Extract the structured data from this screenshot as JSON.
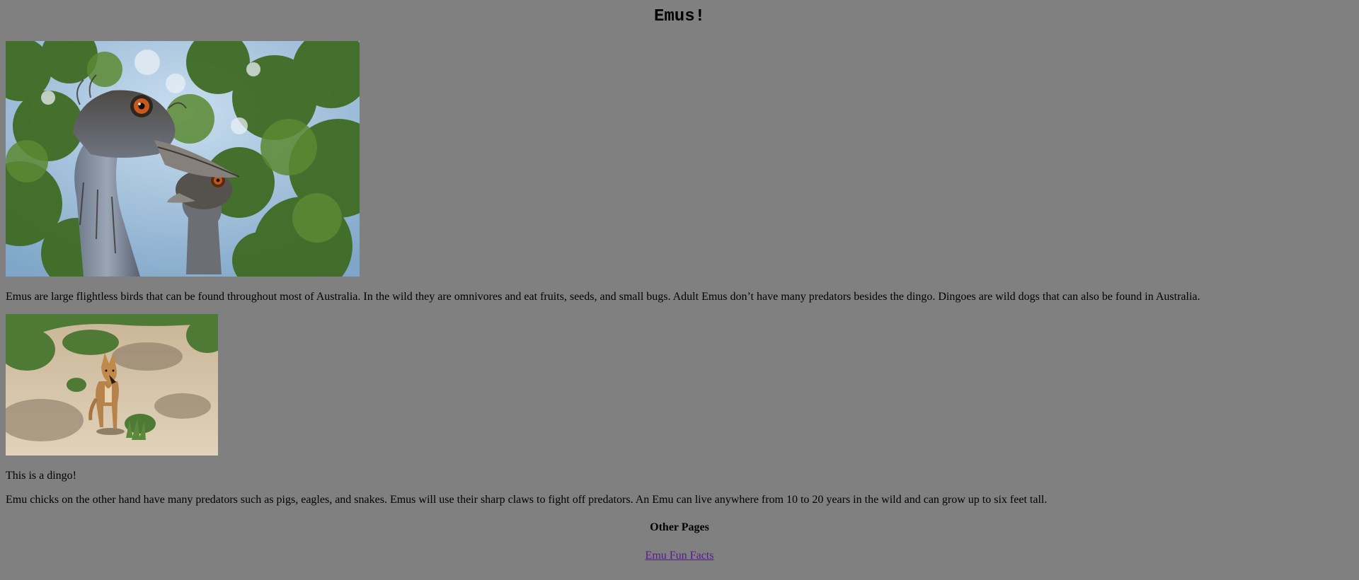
{
  "page": {
    "title": "Emus!",
    "background_color": "#808080"
  },
  "images": {
    "emu": {
      "depicts": "emu-heads-photo"
    },
    "dingo": {
      "depicts": "dingo-photo"
    }
  },
  "content": {
    "paragraph_emus": "Emus are large flightless birds that can be found throughout most of Australia. In the wild they are omnivores and eat fruits, seeds, and small bugs. Adult Emus don’t have many predators besides the dingo. Dingoes are wild dogs that can also be found in Australia.",
    "dingo_caption": "This is a dingo!",
    "paragraph_chicks": "Emu chicks on the other hand have many predators such as pigs, eagles, and snakes. Emus will use their sharp claws to fight off predators. An Emu can live anywhere from 10 to 20 years in the wild and can grow up to six feet tall."
  },
  "nav": {
    "heading": "Other Pages",
    "links": [
      {
        "label": "Emu Fun Facts",
        "color": "#551a8b"
      }
    ]
  }
}
